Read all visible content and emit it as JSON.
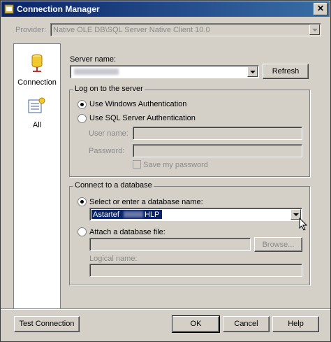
{
  "window": {
    "title": "Connection Manager",
    "close_glyph": "✕"
  },
  "provider": {
    "label": "Provider:",
    "value": "Native OLE DB\\SQL Server Native Client 10.0"
  },
  "sidebar": {
    "items": [
      {
        "label": "Connection",
        "icon": "database-connection-icon"
      },
      {
        "label": "All",
        "icon": "property-list-icon"
      }
    ]
  },
  "server": {
    "label": "Server name:",
    "value": "",
    "refresh_label": "Refresh"
  },
  "logon": {
    "title": "Log on to the server",
    "windows_auth_label": "Use Windows Authentication",
    "sql_auth_label": "Use SQL Server Authentication",
    "user_name_label": "User name:",
    "password_label": "Password:",
    "save_password_label": "Save my password",
    "selected": "windows"
  },
  "database": {
    "title": "Connect to a database",
    "select_label": "Select or enter a database name:",
    "db_name_prefix": "Astartef",
    "db_name_suffix": "HLP",
    "attach_label": "Attach a database file:",
    "browse_label": "Browse...",
    "logical_name_label": "Logical name:",
    "selected": "select"
  },
  "buttons": {
    "test": "Test Connection",
    "ok": "OK",
    "cancel": "Cancel",
    "help": "Help"
  }
}
